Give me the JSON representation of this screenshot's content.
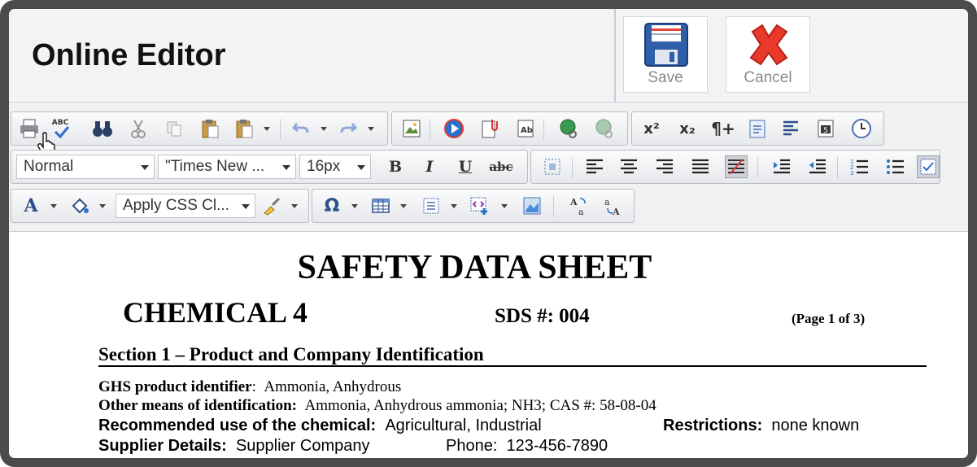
{
  "header": {
    "title": "Online Editor",
    "save_label": "Save",
    "cancel_label": "Cancel"
  },
  "toolbar": {
    "format_value": "Normal",
    "font_value": "\"Times New ...",
    "size_value": "16px",
    "css_class_value": "Apply CSS Cl...",
    "bold_glyph": "B",
    "italic_glyph": "I",
    "underline_glyph": "U",
    "strike_glyph": "abc",
    "sup_glyph": "x²",
    "sub_glyph": "x₂",
    "para_glyph": "¶+",
    "spell_glyph": "ABC",
    "omega_glyph": "Ω",
    "color_glyph": "A"
  },
  "document": {
    "title": "SAFETY DATA SHEET",
    "chemical": "CHEMICAL 4",
    "sds_number": "SDS #: 004",
    "page": "(Page 1 of 3)",
    "section_heading": "Section 1 – Product and Company Identification",
    "ghs_label": "GHS product identifier",
    "ghs_value": "Ammonia, Anhydrous",
    "other_label": "Other means of identification:",
    "other_value": "Ammonia, Anhydrous ammonia; NH3; CAS #: 58-08-04",
    "rec_label": "Recommended use of the chemical:",
    "rec_value": "Agricultural, Industrial",
    "restr_label": "Restrictions:",
    "restr_value": "none known",
    "supplier_label": "Supplier Details:",
    "supplier_value": "Supplier Company",
    "phone_label": "Phone:",
    "phone_value": "123-456-7890"
  },
  "colors": {
    "frame": "#4b4b4b",
    "cancel_red": "#e8392b",
    "save_blue": "#2f5fa8"
  }
}
